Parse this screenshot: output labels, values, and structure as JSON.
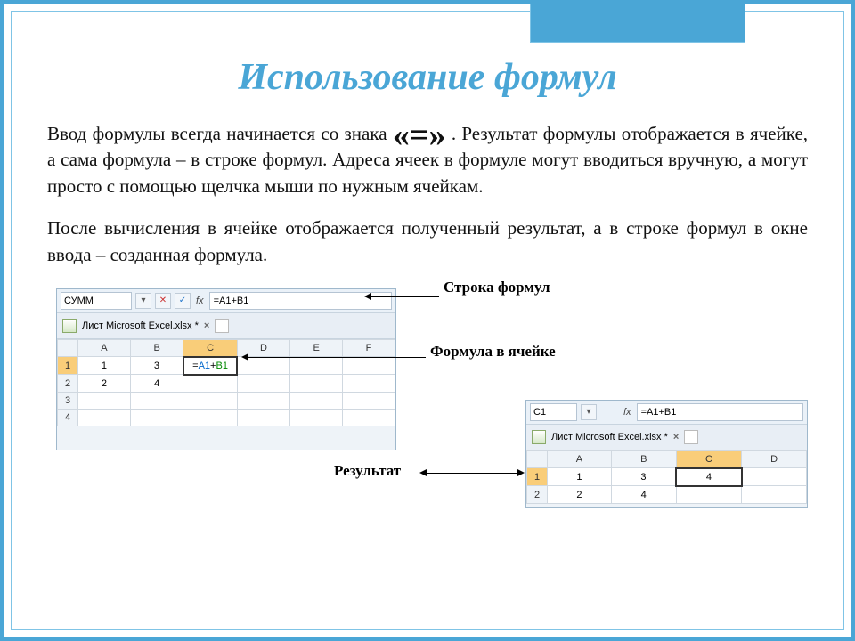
{
  "title": "Использование формул",
  "paragraphs": {
    "p1_a": "Ввод формулы всегда начинается со знака ",
    "p1_equals": "«=»",
    "p1_b": ". Результат формулы отображается в ячейке, а сама формула – в строке формул. Адреса ячеек в формуле могут вводиться вручную, а могут просто с помощью щелчка мыши по нужным ячейкам.",
    "p2": "После вычисления в ячейке отображается полученный результат, а в строке формул в окне ввода – созданная формула."
  },
  "annotations": {
    "formula_bar": "Строка формул",
    "formula_in_cell": "Формула в ячейке",
    "result": "Результат"
  },
  "excel_left": {
    "name_box": "СУММ",
    "fx": "fx",
    "formula": "=A1+B1",
    "tab_title": "Лист Microsoft Excel.xlsx *",
    "cols": [
      "A",
      "B",
      "C",
      "D",
      "E",
      "F"
    ],
    "rows": [
      "1",
      "2",
      "3",
      "4"
    ],
    "cells": {
      "A1": "1",
      "B1": "3",
      "C1": "=A1+B1",
      "A2": "2",
      "B2": "4"
    },
    "formula_tokens": {
      "eq": "=",
      "ref1": "A1",
      "plus": "+",
      "ref2": "B1"
    }
  },
  "excel_right": {
    "name_box": "C1",
    "fx": "fx",
    "formula": "=A1+B1",
    "tab_title": "Лист Microsoft Excel.xlsx *",
    "cols": [
      "A",
      "B",
      "C",
      "D"
    ],
    "rows": [
      "1",
      "2"
    ],
    "cells": {
      "A1": "1",
      "B1": "3",
      "C1": "4",
      "A2": "2",
      "B2": "4"
    }
  },
  "icons": {
    "dropdown": "▾",
    "cancel": "✕",
    "confirm": "✓",
    "close": "×"
  }
}
